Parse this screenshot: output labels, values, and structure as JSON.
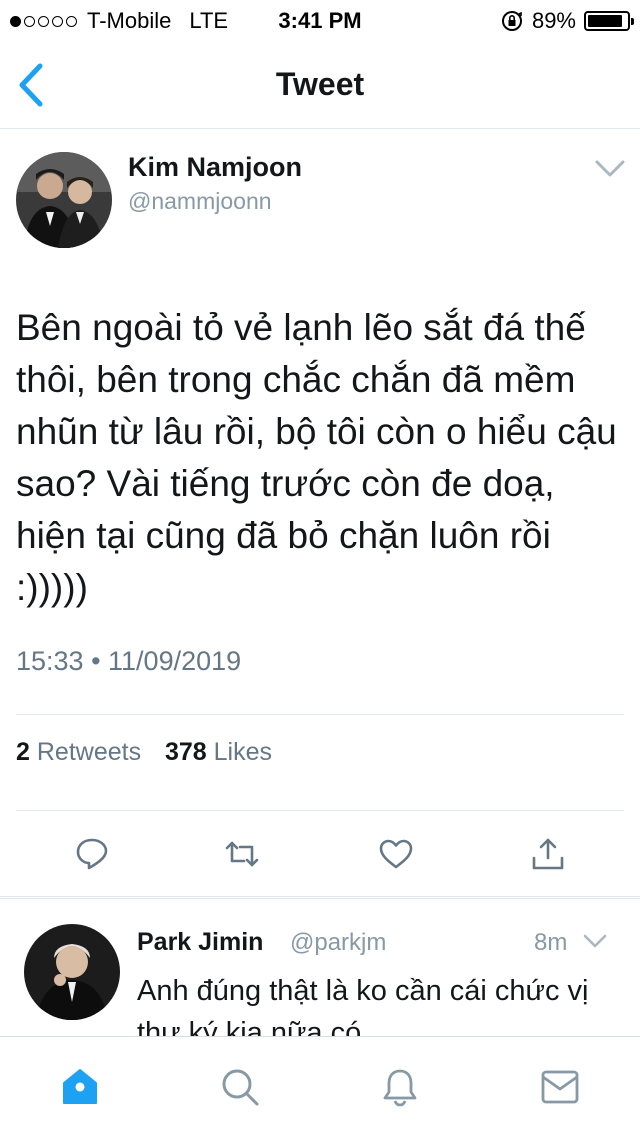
{
  "status_bar": {
    "carrier": "T-Mobile",
    "network": "LTE",
    "time": "3:41 PM",
    "battery": "89%",
    "battery_level": 0.89,
    "signal_bars_filled": 1,
    "signal_bars_total": 5
  },
  "nav": {
    "title": "Tweet",
    "back_icon": "chevron-left-icon"
  },
  "tweet": {
    "author_name": "Kim Namjoon",
    "author_handle": "@nammjoonn",
    "text": "Bên ngoài tỏ vẻ lạnh lẽo sắt đá thế thôi, bên trong chắc chắn đã mềm nhũn từ lâu rồi, bộ tôi còn o hiểu cậu sao? Vài tiếng trước còn đe doạ, hiện tại cũng đã bỏ chặn luôn rồi :)))))",
    "timestamp": "15:33 • 11/09/2019",
    "retweets_count": "2",
    "retweets_label": "Retweets",
    "likes_count": "378",
    "likes_label": "Likes"
  },
  "reply": {
    "author_name": "Park Jimin",
    "author_handle": "@parkjm",
    "time": "8m",
    "text": "Anh đúng thật là ko cần cái chức vị thư ký kia nữa có"
  },
  "colors": {
    "accent": "#1da1f2",
    "text": "#14171a",
    "secondary": "#657786",
    "icon_gray": "#8899a6",
    "divider": "#e1e8ed"
  },
  "tab_bar": {
    "items": [
      "home-icon",
      "search-icon",
      "notifications-icon",
      "messages-icon"
    ],
    "active": "home-icon"
  }
}
